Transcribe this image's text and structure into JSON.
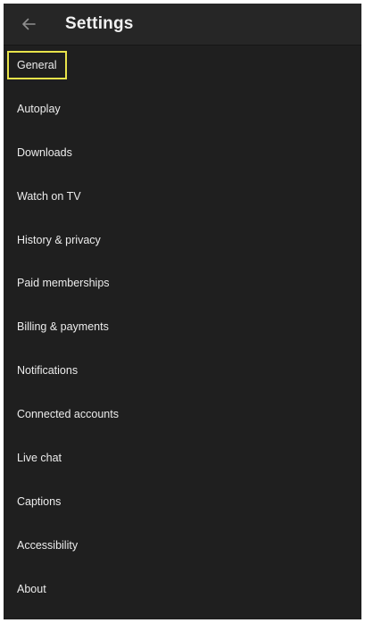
{
  "app_bar": {
    "back_icon": "arrow-left-icon",
    "title": "Settings"
  },
  "menu": {
    "focused_index": 0,
    "focus_color": "#e8e34a",
    "items": [
      {
        "label": "General"
      },
      {
        "label": "Autoplay"
      },
      {
        "label": "Downloads"
      },
      {
        "label": "Watch on TV"
      },
      {
        "label": "History & privacy"
      },
      {
        "label": "Paid memberships"
      },
      {
        "label": "Billing & payments"
      },
      {
        "label": "Notifications"
      },
      {
        "label": "Connected accounts"
      },
      {
        "label": "Live chat"
      },
      {
        "label": "Captions"
      },
      {
        "label": "Accessibility"
      },
      {
        "label": "About"
      }
    ]
  },
  "colors": {
    "background": "#1f1f1f",
    "app_bar": "#262626",
    "text": "#ececec"
  }
}
